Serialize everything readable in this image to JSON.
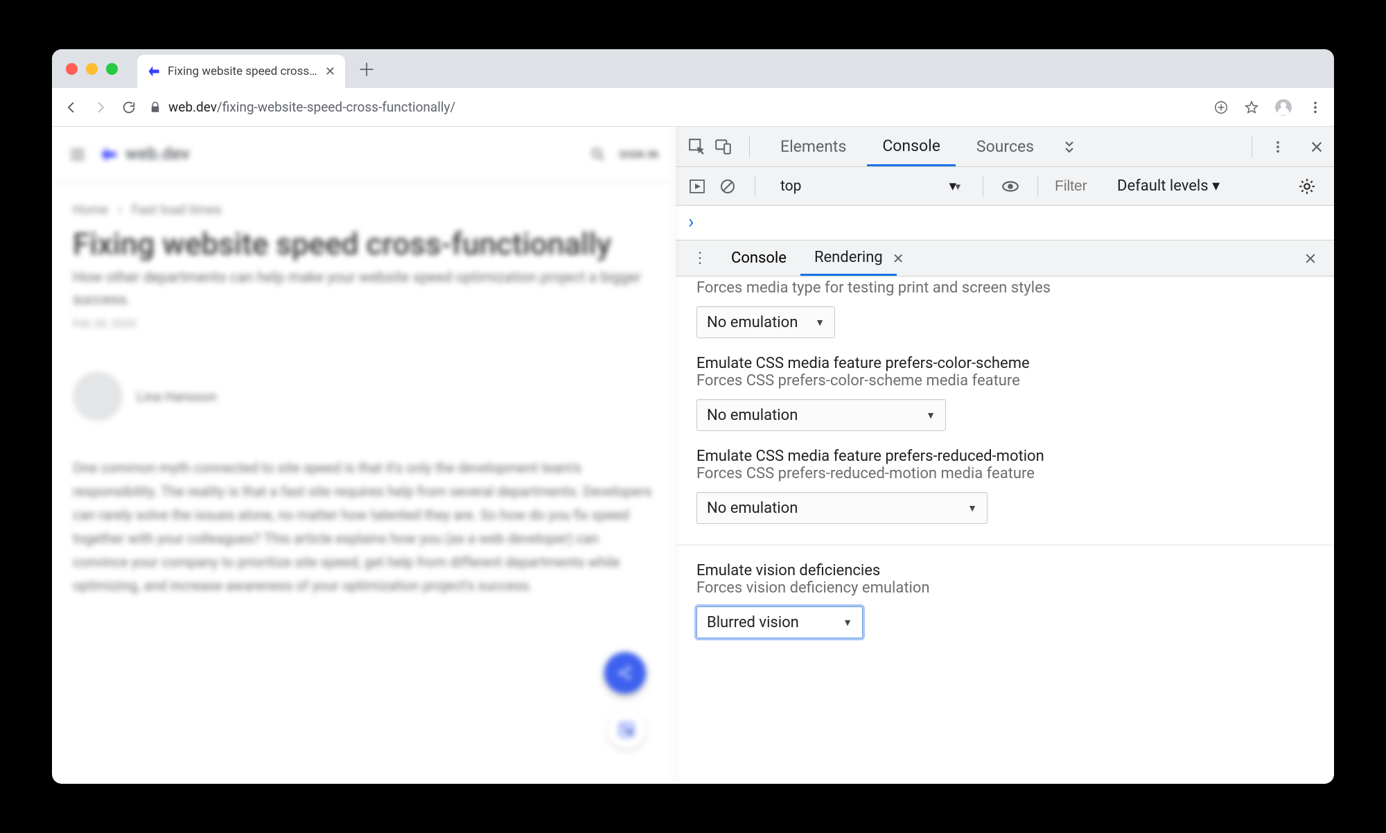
{
  "browser": {
    "tab_title": "Fixing website speed cross-fu…",
    "url_host": "web.dev",
    "url_path": "/fixing-website-speed-cross-functionally/"
  },
  "page": {
    "brand": "web.dev",
    "signin": "SIGN IN",
    "crumb1": "Home",
    "crumb2": "Fast load times",
    "title": "Fixing website speed cross-functionally",
    "subtitle": "How other departments can help make your website speed optimization project a bigger success.",
    "date": "Feb 28, 2020",
    "author": "Lina Hansson",
    "body": "One common myth connected to site speed is that it's only the development team's responsibility. The reality is that a fast site requires help from several departments. Developers can rarely solve the issues alone, no matter how talented they are. So how do you fix speed together with your colleagues? This article explains how you (as a web developer) can convince your company to prioritize site speed, get help from different departments while optimizing, and increase awareness of your optimization project's success."
  },
  "devtools": {
    "tabs": {
      "elements": "Elements",
      "console": "Console",
      "sources": "Sources"
    },
    "console_bar": {
      "context": "top",
      "filter_placeholder": "Filter",
      "levels": "Default levels ▾"
    },
    "drawer": {
      "console": "Console",
      "rendering": "Rendering"
    },
    "rendering": {
      "media_desc": "Forces media type for testing print and screen styles",
      "media_value": "No emulation",
      "pcs_title": "Emulate CSS media feature prefers-color-scheme",
      "pcs_desc": "Forces CSS prefers-color-scheme media feature",
      "pcs_value": "No emulation",
      "prm_title": "Emulate CSS media feature prefers-reduced-motion",
      "prm_desc": "Forces CSS prefers-reduced-motion media feature",
      "prm_value": "No emulation",
      "vis_title": "Emulate vision deficiencies",
      "vis_desc": "Forces vision deficiency emulation",
      "vis_value": "Blurred vision"
    }
  }
}
